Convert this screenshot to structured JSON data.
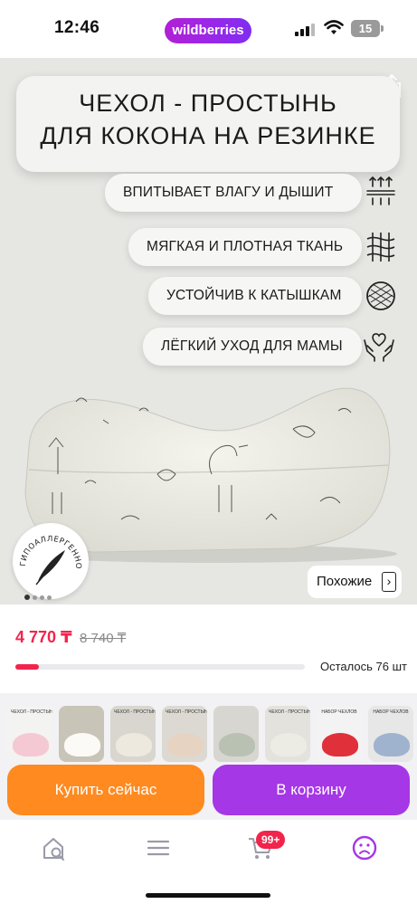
{
  "status_bar": {
    "time": "12:46",
    "app_pill": "wildberries",
    "battery": "15"
  },
  "product_image": {
    "title_lines": [
      "ЧЕХОЛ - ПРОСТЫНЬ",
      "ДЛЯ КОКОНА НА РЕЗИНКЕ"
    ],
    "features": [
      {
        "label": "ВПИТЫВАЕТ ВЛАГУ И ДЫШИТ",
        "icon": "breathable-fabric-icon"
      },
      {
        "label": "МЯГКАЯ И ПЛОТНАЯ ТКАНЬ",
        "icon": "dense-weave-icon"
      },
      {
        "label": "УСТОЙЧИВ К КАТЫШКАМ",
        "icon": "pilling-resistant-icon"
      },
      {
        "label": "ЛЁГКИЙ УХОД ДЛЯ МАМЫ",
        "icon": "heart-hands-icon"
      }
    ],
    "hypoallergenic_badge": "ГИПОАЛЛЕРГЕННО",
    "similar_label": "Похожие",
    "slide_index": 1,
    "slide_count": 4
  },
  "price": {
    "current": "4 770 ₸",
    "old": "8 740 ₸",
    "stock_text": "Осталось 76 шт",
    "stock_level": 0.08
  },
  "thumbnails": [
    {
      "caption": "ЧЕХОЛ - ПРОСТЫНЬ ДЛЯ КОКОНА",
      "color": "#f4c9d4",
      "bg": "#f3f3f1"
    },
    {
      "caption": "",
      "color": "#fbfaf6",
      "bg": "#c9c4b8"
    },
    {
      "caption": "ЧЕХОЛ - ПРОСТЫНЬ ДЛЯ КОКОНА",
      "color": "#ede9df",
      "bg": "#d9d6cf"
    },
    {
      "caption": "ЧЕХОЛ - ПРОСТЫНЬ ДЛЯ КОКОНА",
      "color": "#e6d3c2",
      "bg": "#dcd9d3"
    },
    {
      "caption": "",
      "color": "#b9c2b2",
      "bg": "#d8d6d0"
    },
    {
      "caption": "ЧЕХОЛ - ПРОСТЫНЬ ДЛЯ КОКОНА",
      "color": "#ecebe4",
      "bg": "#e3e2dd"
    },
    {
      "caption": "НАБОР ЧЕХЛОВ",
      "color": "#e0303a",
      "bg": "#f3f3f3"
    },
    {
      "caption": "НАБОР ЧЕХЛОВ",
      "color": "#9fb3cf",
      "bg": "#e7e7e7"
    }
  ],
  "actions": {
    "buy_now": "Купить сейчас",
    "add_to_cart": "В корзину"
  },
  "bottom_nav": {
    "cart_badge": "99+",
    "accent": "#a537e6"
  },
  "colors": {
    "price_red": "#f2244c",
    "buy_orange": "#ff8a1f",
    "cart_purple": "#a537e6"
  }
}
